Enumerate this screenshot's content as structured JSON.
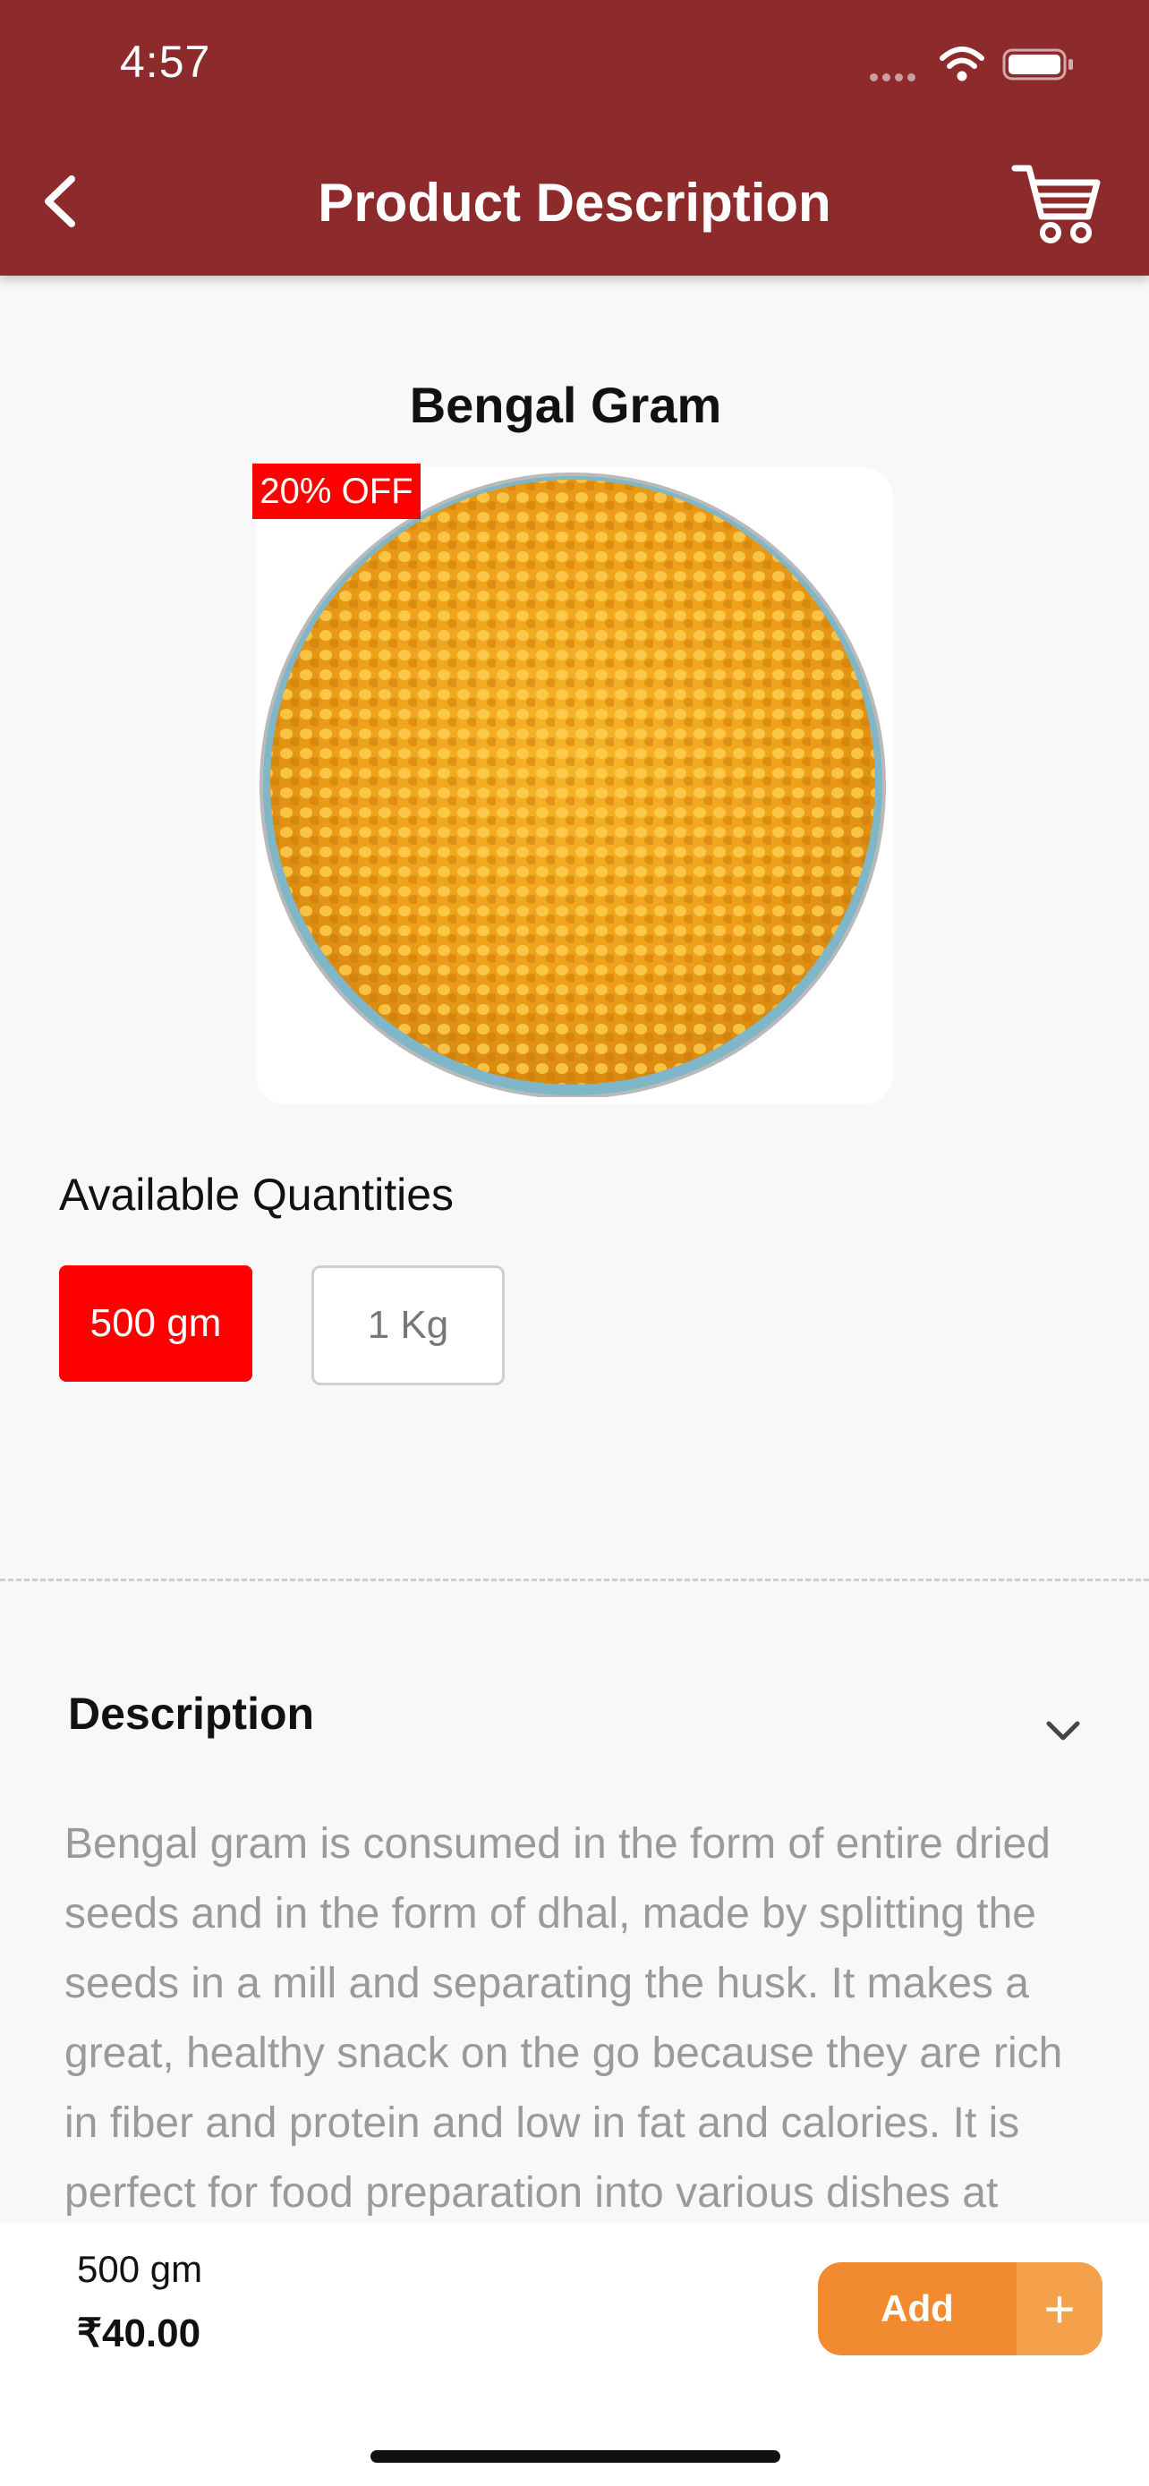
{
  "status_bar": {
    "time": "4:57"
  },
  "header": {
    "title": "Product Description",
    "back_icon": "chevron-left-icon",
    "cart_icon": "cart-icon"
  },
  "product": {
    "name": "Bengal Gram",
    "discount_badge": "20% OFF"
  },
  "quantities": {
    "heading": "Available Quantities",
    "options": [
      {
        "label": "500 gm",
        "selected": true
      },
      {
        "label": "1 Kg",
        "selected": false
      }
    ]
  },
  "description": {
    "heading": "Description",
    "text": "Bengal gram is consumed in the form of entire dried seeds and in the form of dhal, made by splitting the seeds in a mill and separating the husk. It makes a great, healthy snack on the go because they are rich in fiber and protein and low in fat and calories. It is perfect for food preparation into various dishes at"
  },
  "footer": {
    "selected_qty": "500 gm",
    "price": "₹40.00",
    "add_label": "Add",
    "plus_label": "+"
  },
  "colors": {
    "header": "#8c2a2c",
    "accent_red": "#ff0000",
    "add_orange": "#f28a2f"
  }
}
